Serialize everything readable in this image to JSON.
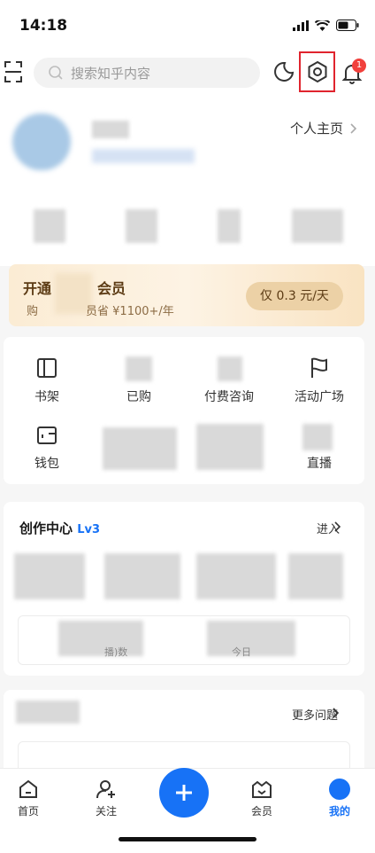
{
  "status_bar": {
    "time": "14:18"
  },
  "search": {
    "placeholder": "搜索知乎内容"
  },
  "notifications": {
    "badge_count": "1"
  },
  "profile": {
    "home_link": "个人主页"
  },
  "vip": {
    "title_prefix": "开通",
    "title_suffix": "会员",
    "subtitle_part1": "购",
    "subtitle_part2": "员省 ¥1100+/年",
    "button": "仅 0.3 元/天"
  },
  "services": {
    "items": [
      {
        "label": "书架"
      },
      {
        "label": "已购"
      },
      {
        "label": "付费咨询"
      },
      {
        "label": "活动广场"
      },
      {
        "label": "钱包"
      },
      {
        "label": ""
      },
      {
        "label": ""
      },
      {
        "label": "直播"
      }
    ]
  },
  "creation": {
    "title": "创作中心",
    "level": "Lv3",
    "enter": "进入",
    "stat_label_1": "播)数",
    "stat_label_2": "今日"
  },
  "questions": {
    "more": "更多问题"
  },
  "tabbar": {
    "home": "首页",
    "follow": "关注",
    "member": "会员",
    "mine": "我的"
  },
  "colors": {
    "accent": "#1772f6",
    "badge": "#f1403c",
    "highlight": "#e0242e"
  }
}
